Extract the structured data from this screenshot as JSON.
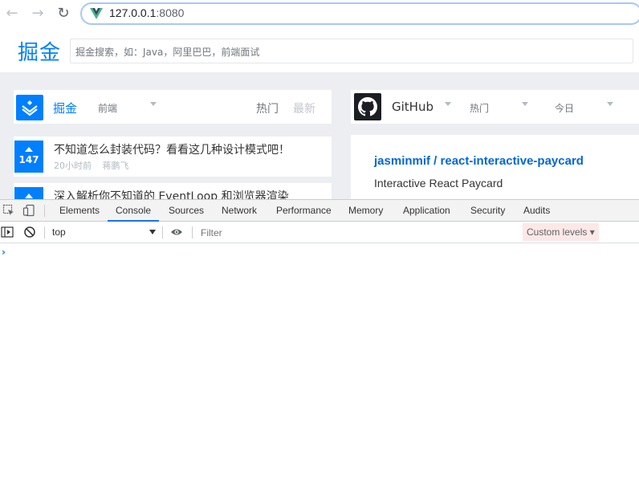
{
  "browser": {
    "url_host": "127.0.0.1",
    "url_port": ":8080"
  },
  "site": {
    "logo": "掘金",
    "search_placeholder": "掘金搜索，如：Java，阿里巴巴，前端面试"
  },
  "juejin_panel": {
    "title": "掘金",
    "category": "前端",
    "sort_hot": "热门",
    "sort_new": "最新",
    "items": [
      {
        "votes": "147",
        "title": "不知道怎么封装代码？看看这几种设计模式吧！",
        "time": "20小时前",
        "author": "蒋鹏飞"
      },
      {
        "votes": "",
        "title": "深入解析你不知道的 EventLoop 和浏览器渲染",
        "time": "",
        "author": ""
      }
    ]
  },
  "github_panel": {
    "title": "GitHub",
    "language": "热门",
    "period": "今日",
    "repo_name": "jasminmif / react-interactive-paycard",
    "repo_desc": "Interactive React Paycard"
  },
  "devtools": {
    "tabs": [
      "Elements",
      "Console",
      "Sources",
      "Network",
      "Performance",
      "Memory",
      "Application",
      "Security",
      "Audits"
    ],
    "active_tab": "Console",
    "context": "top",
    "filter_placeholder": "Filter",
    "levels": "Custom levels",
    "prompt": "›"
  },
  "colors": {
    "juejin_blue": "#007fff",
    "link_blue": "#0366d6",
    "page_bg": "#eceef1"
  }
}
